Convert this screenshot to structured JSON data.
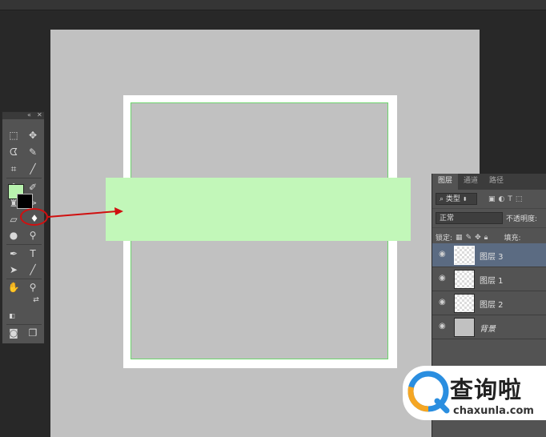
{
  "layers_panel": {
    "tabs": [
      "图层",
      "通道",
      "路径"
    ],
    "filter_kind": "类型",
    "blend_mode": "正常",
    "opacity_label": "不透明度:",
    "lock_label": "锁定:",
    "fill_label": "填充:",
    "layers": [
      {
        "name": "图层 3",
        "selected": true
      },
      {
        "name": "图层 1",
        "selected": false
      },
      {
        "name": "图层 2",
        "selected": false
      },
      {
        "name": "背景",
        "selected": false
      }
    ]
  },
  "toolbox": {
    "foreground_color": "#b8f2ae",
    "background_color": "#000000",
    "highlighted_tool": "paint-bucket-icon"
  },
  "canvas": {
    "fill_color": "#c2f7b9",
    "annotation_color": "#d01010"
  },
  "watermark": {
    "cn": "查询啦",
    "en": "chaxunla.com"
  }
}
